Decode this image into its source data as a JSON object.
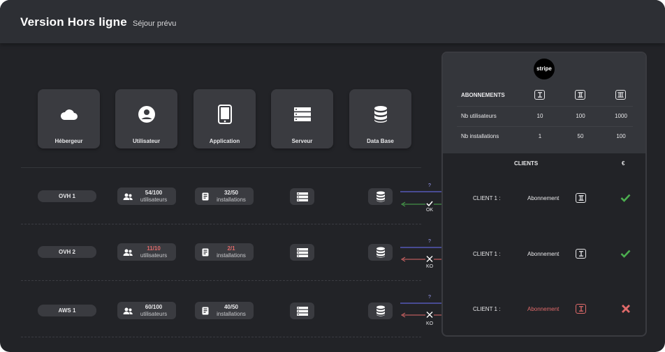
{
  "header": {
    "title": "Version Hors ligne",
    "subtitle": "Séjour prévu"
  },
  "categories": [
    {
      "label": "Hébergeur",
      "icon": "cloud-icon"
    },
    {
      "label": "Utilisateur",
      "icon": "user-circle-icon"
    },
    {
      "label": "Application",
      "icon": "tablet-icon"
    },
    {
      "label": "Serveur",
      "icon": "server-icon"
    },
    {
      "label": "Data Base",
      "icon": "database-icon"
    }
  ],
  "rows": [
    {
      "host": "OVH 1",
      "users_value": "54/100",
      "users_unit": "utilisateurs",
      "installs_value": "32/50",
      "installs_unit": "installations",
      "request_label": "?",
      "response_label": "OK",
      "response_status": "ok"
    },
    {
      "host": "OVH 2",
      "users_value": "11/10",
      "users_unit": "utilisateurs",
      "installs_value": "2/1",
      "installs_unit": "installations",
      "request_label": "?",
      "response_label": "KO",
      "response_status": "ko"
    },
    {
      "host": "AWS 1",
      "users_value": "60/100",
      "users_unit": "utilisateurs",
      "installs_value": "40/50",
      "installs_unit": "installations",
      "request_label": "?",
      "response_label": "KO",
      "response_status": "ko"
    }
  ],
  "stripe": {
    "logo_text": "stripe",
    "table_header": "ABONNEMENTS",
    "tiers": [
      "I",
      "II",
      "III"
    ],
    "rows": [
      {
        "label": "Nb utilisateurs",
        "values": [
          "10",
          "100",
          "1000"
        ]
      },
      {
        "label": "Nb installations",
        "values": [
          "1",
          "50",
          "100"
        ]
      }
    ]
  },
  "clients": {
    "header": "CLIENTS",
    "currency_header": "€",
    "items": [
      {
        "name": "CLIENT 1 :",
        "plan_label": "Abonnement",
        "tier": "II",
        "status": "paid"
      },
      {
        "name": "CLIENT 1 :",
        "plan_label": "Abonnement",
        "tier": "I",
        "status": "paid"
      },
      {
        "name": "CLIENT 1 :",
        "plan_label": "Abonnement",
        "tier": "I",
        "status": "unpaid"
      }
    ]
  },
  "colors": {
    "ok": "#4cae4f",
    "ko": "#e06a6a",
    "request": "#6f73ff"
  }
}
